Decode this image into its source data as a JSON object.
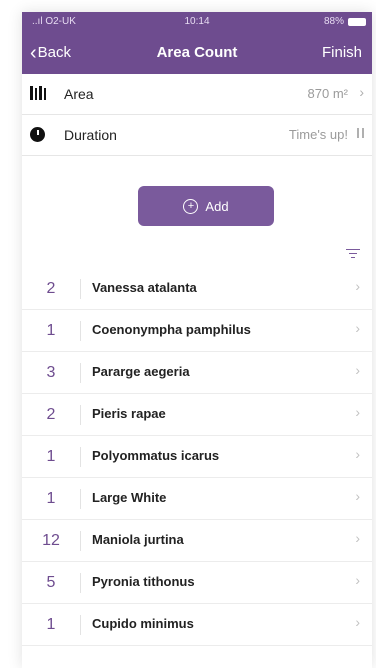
{
  "status_bar": {
    "carrier": "..ıl O2-UK",
    "time": "10:14",
    "battery": "88%"
  },
  "nav": {
    "back_label": "Back",
    "title": "Area Count",
    "finish_label": "Finish"
  },
  "info": {
    "area": {
      "label": "Area",
      "value": "870 m²"
    },
    "duration": {
      "label": "Duration",
      "value": "Time's up!"
    }
  },
  "add_button": {
    "label": "Add"
  },
  "species": [
    {
      "count": "2",
      "name": "Vanessa atalanta"
    },
    {
      "count": "1",
      "name": "Coenonympha pamphilus"
    },
    {
      "count": "3",
      "name": "Pararge aegeria"
    },
    {
      "count": "2",
      "name": "Pieris rapae"
    },
    {
      "count": "1",
      "name": "Polyommatus icarus"
    },
    {
      "count": "1",
      "name": "Large White"
    },
    {
      "count": "12",
      "name": "Maniola jurtina"
    },
    {
      "count": "5",
      "name": "Pyronia tithonus"
    },
    {
      "count": "1",
      "name": "Cupido minimus"
    }
  ],
  "colors": {
    "header": "#6e4c8f",
    "accent": "#7a5a9c"
  },
  "icons": {
    "area": "area-bars-icon",
    "duration": "clock-icon",
    "add": "plus-circle-icon",
    "sort": "sort-filter-icon",
    "row": "chevron-right-icon"
  }
}
